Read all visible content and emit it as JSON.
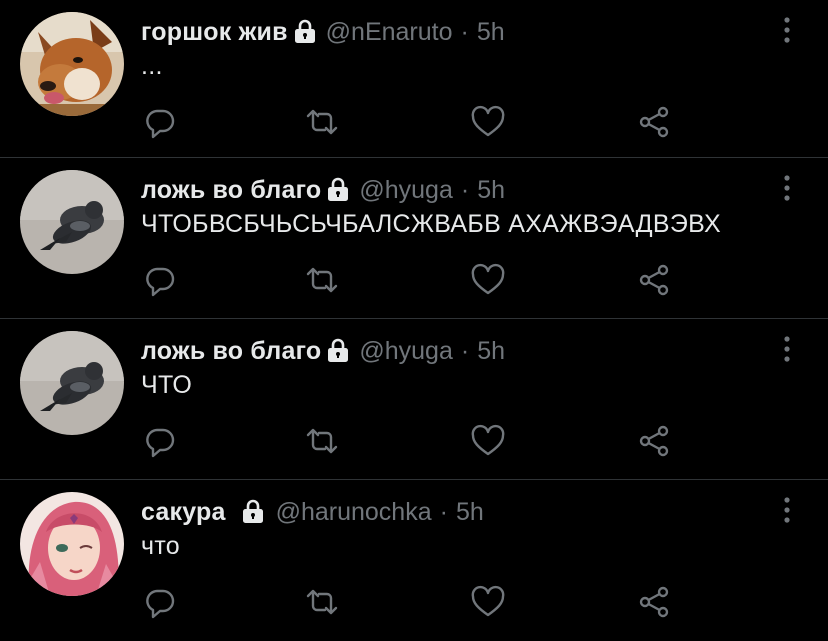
{
  "colors": {
    "background": "#000000",
    "text_primary": "#e7e9ea",
    "text_secondary": "#71767b",
    "divider": "#2f3336"
  },
  "tweets": [
    {
      "display_name": "горшок жив",
      "handle": "@nEnaruto",
      "separator": "·",
      "time": "5h",
      "text": "...",
      "protected": true,
      "avatar_icon": "fox-avatar"
    },
    {
      "display_name": "ложь во благо",
      "handle": "@hyuga",
      "separator": "·",
      "time": "5h",
      "text": "ЧТОБВСБЧЬСЬЧБАЛСЖВАБВ АХАЖВЭАДВЭВХ",
      "protected": true,
      "avatar_icon": "pigeon-avatar"
    },
    {
      "display_name": "ложь во благо",
      "handle": "@hyuga",
      "separator": "·",
      "time": "5h",
      "text": "ЧТО",
      "protected": true,
      "avatar_icon": "pigeon-avatar"
    },
    {
      "display_name": "сакура",
      "handle": "@harunochka",
      "separator": "·",
      "time": "5h",
      "text": "что",
      "protected": true,
      "avatar_icon": "anime-girl-avatar"
    }
  ],
  "icons": {
    "lock": "lock-icon",
    "more": "more-vertical-icon",
    "reply": "reply-icon",
    "retweet": "retweet-icon",
    "like": "heart-icon",
    "share": "share-icon"
  }
}
